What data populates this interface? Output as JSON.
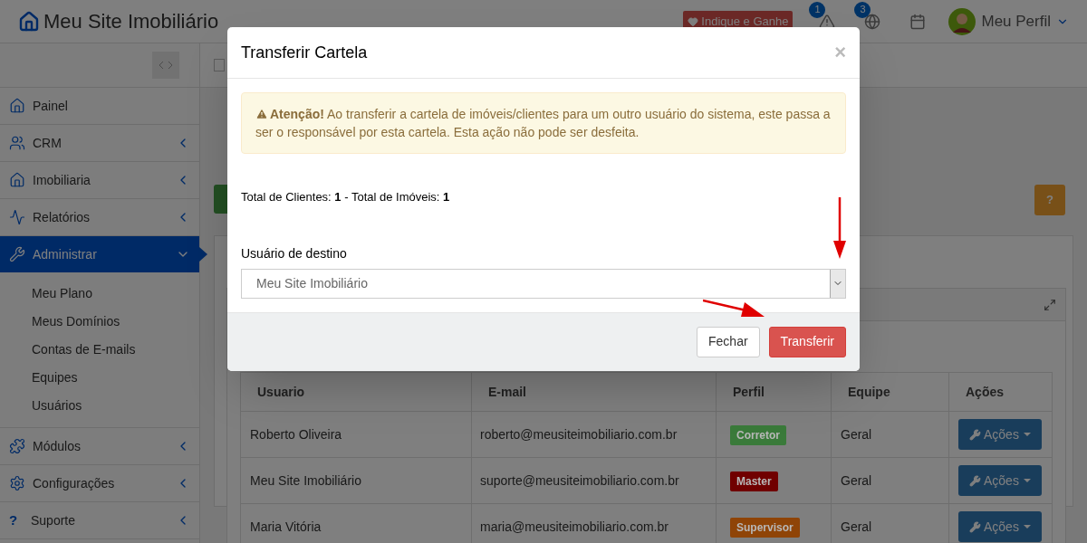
{
  "header": {
    "logo": "Meu Site Imobiliário",
    "refer_button": "Indique e Ganhe",
    "notifications": [
      {
        "kind": "alert",
        "count": "1"
      },
      {
        "kind": "globe",
        "count": "3"
      },
      {
        "kind": "calendar"
      }
    ],
    "profile": "Meu Perfil"
  },
  "sidebar": {
    "items": [
      {
        "label": "Painel",
        "selected": false
      },
      {
        "label": "CRM",
        "selected": false,
        "expanded": false
      },
      {
        "label": "Imobiliaria",
        "selected": false,
        "expanded": false
      },
      {
        "label": "Relatórios",
        "selected": false,
        "expanded": false
      },
      {
        "label": "Administrar",
        "selected": true,
        "expanded": true,
        "children": [
          {
            "label": "Meu Plano"
          },
          {
            "label": "Meus Domínios"
          },
          {
            "label": "Contas de E-mails"
          },
          {
            "label": "Equipes"
          },
          {
            "label": "Usuários"
          }
        ]
      },
      {
        "label": "Módulos",
        "selected": false,
        "expanded": false
      },
      {
        "label": "Configurações",
        "selected": false,
        "expanded": false
      },
      {
        "label": "Suporte",
        "glyph": "?",
        "selected": false,
        "expanded": false
      }
    ]
  },
  "help_button": "?",
  "table": {
    "columns": [
      "Usuario",
      "E-mail",
      "Perfil",
      "Equipe",
      "Ações"
    ],
    "rows": [
      {
        "usuario": "Roberto Oliveira",
        "email": "roberto@meusiteimobiliario.com.br",
        "perfil": "Corretor",
        "color": "#3a7a3a",
        "equipe": "Geral",
        "action": "Ações"
      },
      {
        "usuario": "Meu Site Imobiliário",
        "email": "suporte@meusiteimobiliario.com.br",
        "perfil": "Master",
        "color": "#700000",
        "equipe": "Geral",
        "action": "Ações"
      },
      {
        "usuario": "Maria Vitória",
        "email": "maria@meusiteimobiliario.com.br",
        "perfil": "Supervisor",
        "color": "#8f4407",
        "equipe": "Geral",
        "action": "Ações"
      }
    ]
  },
  "modal": {
    "title": "Transferir Cartela",
    "close": "×",
    "alert": "**Atenção!** Ao transferir a cartela de imóveis/clientes para um outro usuário do sistema, este passa a ser o responsável por esta cartela. Esta ação não pode ser desfeita.",
    "totals": "Total de Clientes: **1** - Total de Imóveis: **1**",
    "field_label": "Usuário de destino",
    "select_value": "Meu Site Imobiliário",
    "buttons": [
      {
        "label": "Fechar",
        "kind": "default"
      },
      {
        "label": "Transferir",
        "kind": "danger"
      }
    ]
  }
}
